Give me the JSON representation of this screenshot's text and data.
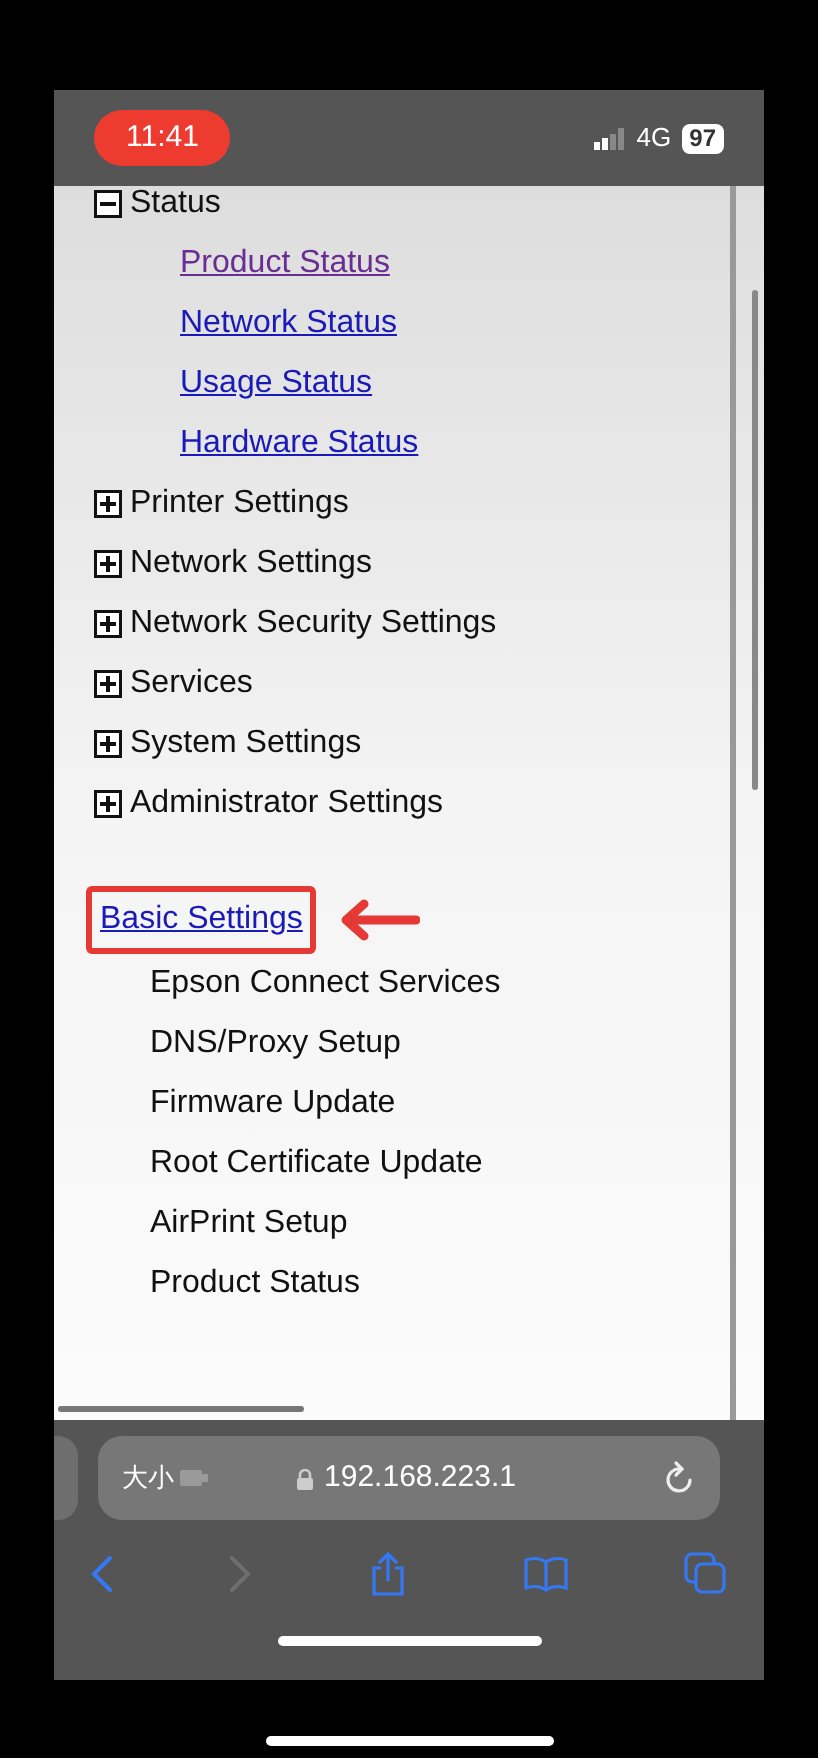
{
  "status_bar": {
    "time": "11:41",
    "network": "4G",
    "battery": "97"
  },
  "menu": [
    {
      "label": "Status",
      "expanded": true,
      "children": [
        {
          "label": "Product Status",
          "visited": true
        },
        {
          "label": "Network Status",
          "visited": false
        },
        {
          "label": "Usage Status",
          "visited": false
        },
        {
          "label": "Hardware Status",
          "visited": false
        }
      ]
    },
    {
      "label": "Printer Settings",
      "expanded": false
    },
    {
      "label": "Network Settings",
      "expanded": false
    },
    {
      "label": "Network Security Settings",
      "expanded": false
    },
    {
      "label": "Services",
      "expanded": false
    },
    {
      "label": "System Settings",
      "expanded": false
    },
    {
      "label": "Administrator Settings",
      "expanded": false
    }
  ],
  "basic_settings": {
    "label": "Basic Settings",
    "highlighted": true,
    "items": [
      "Epson Connect Services",
      "DNS/Proxy Setup",
      "Firmware Update",
      "Root Certificate Update",
      "AirPrint Setup",
      "Product Status"
    ]
  },
  "browser": {
    "site_label": "大小",
    "url": "192.168.223.1"
  }
}
